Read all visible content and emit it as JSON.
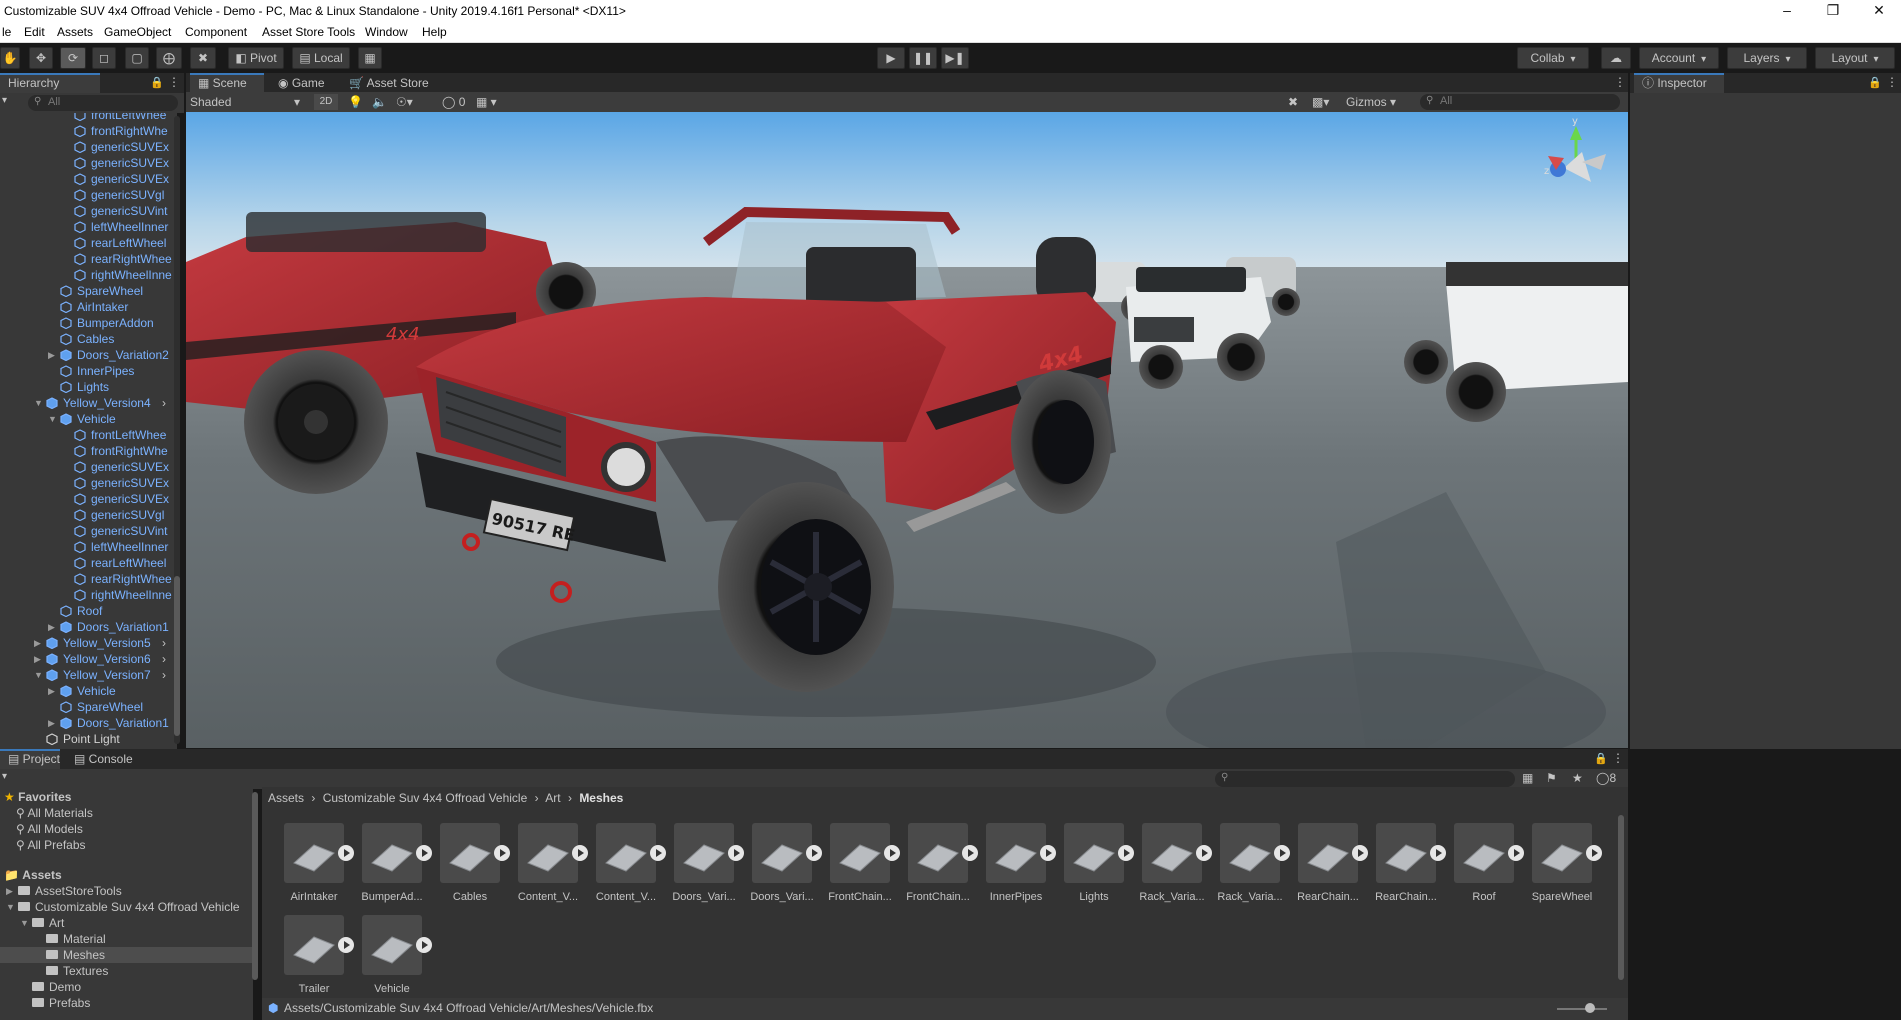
{
  "window": {
    "title": "Customizable SUV 4x4 Offroad Vehicle - Demo - PC, Mac & Linux Standalone - Unity 2019.4.16f1 Personal* <DX11>",
    "controls": [
      "minimize-icon",
      "maximize-icon",
      "close-icon"
    ]
  },
  "menu": [
    "le",
    "Edit",
    "Assets",
    "GameObject",
    "Component",
    "Asset Store Tools",
    "Window",
    "Help"
  ],
  "toolbar": {
    "tools": [
      "hand-icon",
      "move-icon",
      "rotate-icon",
      "scale-icon",
      "rect-icon",
      "transform-icon",
      "custom-tool-icon"
    ],
    "pivot": "Pivot",
    "local": "Local",
    "play_controls": [
      "play-icon",
      "pause-icon",
      "step-icon"
    ],
    "collab": "Collab",
    "account": "Account",
    "layers": "Layers",
    "layout": "Layout"
  },
  "hierarchy": {
    "tab": "Hierarchy",
    "search_placeholder": "All",
    "items": [
      {
        "label": "frontLeftWhee",
        "depth": 3,
        "color": "blue",
        "arrow": ""
      },
      {
        "label": "frontRightWhe",
        "depth": 3,
        "color": "blue",
        "arrow": ""
      },
      {
        "label": "genericSUVEx",
        "depth": 3,
        "color": "blue",
        "arrow": ""
      },
      {
        "label": "genericSUVEx",
        "depth": 3,
        "color": "blue",
        "arrow": ""
      },
      {
        "label": "genericSUVEx",
        "depth": 3,
        "color": "blue",
        "arrow": ""
      },
      {
        "label": "genericSUVgl",
        "depth": 3,
        "color": "blue",
        "arrow": ""
      },
      {
        "label": "genericSUVint",
        "depth": 3,
        "color": "blue",
        "arrow": ""
      },
      {
        "label": "leftWheelInner",
        "depth": 3,
        "color": "blue",
        "arrow": ""
      },
      {
        "label": "rearLeftWheel",
        "depth": 3,
        "color": "blue",
        "arrow": ""
      },
      {
        "label": "rearRightWhee",
        "depth": 3,
        "color": "blue",
        "arrow": ""
      },
      {
        "label": "rightWheelInne",
        "depth": 3,
        "color": "blue",
        "arrow": ""
      },
      {
        "label": "SpareWheel",
        "depth": 2,
        "color": "blue",
        "arrow": ""
      },
      {
        "label": "AirIntaker",
        "depth": 2,
        "color": "blue",
        "arrow": ""
      },
      {
        "label": "BumperAddon",
        "depth": 2,
        "color": "blue",
        "arrow": ""
      },
      {
        "label": "Cables",
        "depth": 2,
        "color": "blue",
        "arrow": ""
      },
      {
        "label": "Doors_Variation2",
        "depth": 2,
        "color": "blue",
        "arrow": "▶"
      },
      {
        "label": "InnerPipes",
        "depth": 2,
        "color": "blue",
        "arrow": ""
      },
      {
        "label": "Lights",
        "depth": 2,
        "color": "blue",
        "arrow": ""
      },
      {
        "label": "Yellow_Version4",
        "depth": 1,
        "color": "blue",
        "arrow": "▼",
        "more": "›"
      },
      {
        "label": "Vehicle",
        "depth": 2,
        "color": "blue",
        "arrow": "▼"
      },
      {
        "label": "frontLeftWhee",
        "depth": 3,
        "color": "blue",
        "arrow": ""
      },
      {
        "label": "frontRightWhe",
        "depth": 3,
        "color": "blue",
        "arrow": ""
      },
      {
        "label": "genericSUVEx",
        "depth": 3,
        "color": "blue",
        "arrow": ""
      },
      {
        "label": "genericSUVEx",
        "depth": 3,
        "color": "blue",
        "arrow": ""
      },
      {
        "label": "genericSUVEx",
        "depth": 3,
        "color": "blue",
        "arrow": ""
      },
      {
        "label": "genericSUVgl",
        "depth": 3,
        "color": "blue",
        "arrow": ""
      },
      {
        "label": "genericSUVint",
        "depth": 3,
        "color": "blue",
        "arrow": ""
      },
      {
        "label": "leftWheelInner",
        "depth": 3,
        "color": "blue",
        "arrow": ""
      },
      {
        "label": "rearLeftWheel",
        "depth": 3,
        "color": "blue",
        "arrow": ""
      },
      {
        "label": "rearRightWhee",
        "depth": 3,
        "color": "blue",
        "arrow": ""
      },
      {
        "label": "rightWheelInne",
        "depth": 3,
        "color": "blue",
        "arrow": ""
      },
      {
        "label": "Roof",
        "depth": 2,
        "color": "blue",
        "arrow": ""
      },
      {
        "label": "Doors_Variation1",
        "depth": 2,
        "color": "blue",
        "arrow": "▶"
      },
      {
        "label": "Yellow_Version5",
        "depth": 1,
        "color": "blue",
        "arrow": "▶",
        "more": "›"
      },
      {
        "label": "Yellow_Version6",
        "depth": 1,
        "color": "blue",
        "arrow": "▶",
        "more": "›"
      },
      {
        "label": "Yellow_Version7",
        "depth": 1,
        "color": "blue",
        "arrow": "▼",
        "more": "›"
      },
      {
        "label": "Vehicle",
        "depth": 2,
        "color": "blue",
        "arrow": "▶"
      },
      {
        "label": "SpareWheel",
        "depth": 2,
        "color": "blue",
        "arrow": ""
      },
      {
        "label": "Doors_Variation1",
        "depth": 2,
        "color": "blue",
        "arrow": "▶"
      },
      {
        "label": "Point Light",
        "depth": 1,
        "color": "white",
        "arrow": ""
      }
    ]
  },
  "scene": {
    "tabs": [
      "Scene",
      "Game",
      "Asset Store"
    ],
    "shading": "Shaded",
    "mode_2d": "2D",
    "hidden_count": "0",
    "gizmos": "Gizmos",
    "search_placeholder": "All",
    "axis_labels": {
      "y": "y",
      "z": "z"
    },
    "plate_text": "90517 RE",
    "badge": "4x4"
  },
  "inspector": {
    "tab": "Inspector"
  },
  "project": {
    "tabs": [
      "Project",
      "Console"
    ],
    "hidden_count": "8",
    "favorites": {
      "title": "Favorites",
      "items": [
        "All Materials",
        "All Models",
        "All Prefabs"
      ]
    },
    "assets_title": "Assets",
    "tree": [
      {
        "label": "AssetStoreTools",
        "depth": 1,
        "arrow": "▶"
      },
      {
        "label": "Customizable Suv 4x4 Offroad Vehicle",
        "depth": 1,
        "arrow": "▼"
      },
      {
        "label": "Art",
        "depth": 2,
        "arrow": "▼"
      },
      {
        "label": "Material",
        "depth": 3,
        "arrow": ""
      },
      {
        "label": "Meshes",
        "depth": 3,
        "arrow": "",
        "selected": true
      },
      {
        "label": "Textures",
        "depth": 3,
        "arrow": ""
      },
      {
        "label": "Demo",
        "depth": 2,
        "arrow": ""
      },
      {
        "label": "Prefabs",
        "depth": 2,
        "arrow": ""
      }
    ],
    "breadcrumb": [
      "Assets",
      "Customizable Suv 4x4 Offroad Vehicle",
      "Art",
      "Meshes"
    ],
    "assets": [
      "AirIntaker",
      "BumperAd...",
      "Cables",
      "Content_V...",
      "Content_V...",
      "Doors_Vari...",
      "Doors_Vari...",
      "FrontChain...",
      "FrontChain...",
      "InnerPipes",
      "Lights",
      "Rack_Varia...",
      "Rack_Varia...",
      "RearChain...",
      "RearChain...",
      "Roof",
      "SpareWheel",
      "Trailer",
      "Vehicle"
    ],
    "path": "Assets/Customizable Suv 4x4 Offroad Vehicle/Art/Meshes/Vehicle.fbx"
  },
  "colors": {
    "accent": "#3a79bb",
    "prefab_blue": "#7bb2ff",
    "panel": "#383838",
    "sky_top": "#5aa6e6",
    "ground": "#5f6669",
    "car_red": "#a3262d"
  }
}
